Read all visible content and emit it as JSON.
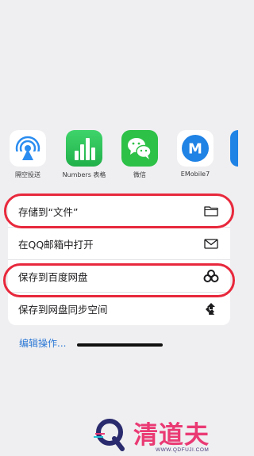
{
  "share_sheet": {
    "apps": [
      {
        "name": "airdrop",
        "label": "隔空投送"
      },
      {
        "name": "numbers",
        "label": "Numbers 表格"
      },
      {
        "name": "wechat",
        "label": "微信"
      },
      {
        "name": "emobile7",
        "label": "EMobile7"
      }
    ],
    "actions": [
      {
        "label": "存储到“文件”",
        "icon": "folder-icon"
      },
      {
        "label": "在QQ邮箱中打开",
        "icon": "mail-icon"
      },
      {
        "label": "保存到百度网盘",
        "icon": "baidu-netdisk-icon"
      },
      {
        "label": "保存到网盘同步空间",
        "icon": "sync-space-icon"
      }
    ],
    "edit_actions": "编辑操作..."
  },
  "colors": {
    "accent_link": "#2f7ad6",
    "annotation": "#e8283c",
    "watermark": "#ea3a74"
  },
  "watermark": {
    "brand": "清道夫",
    "url": "WWW.QDFUJI.COM"
  }
}
